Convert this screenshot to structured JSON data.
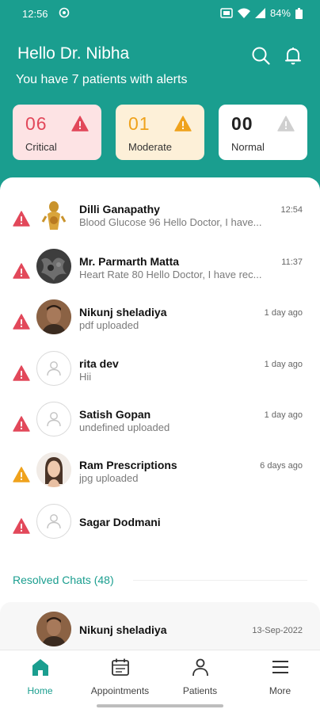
{
  "status_bar": {
    "time": "12:56",
    "battery": "84%"
  },
  "header": {
    "greeting": "Hello Dr. Nibha",
    "subtitle": "You have 7 patients with alerts"
  },
  "summary_cards": {
    "critical": {
      "count": "06",
      "label": "Critical"
    },
    "moderate": {
      "count": "01",
      "label": "Moderate"
    },
    "normal": {
      "count": "00",
      "label": "Normal"
    }
  },
  "chats": [
    {
      "name": "Dilli Ganapathy",
      "message": "Blood Glucose 96 Hello Doctor, I have...",
      "time": "12:54",
      "severity": "critical",
      "avatar": "photo-figurine"
    },
    {
      "name": "Mr. Parmarth Matta",
      "message": "Heart Rate 80 Hello Doctor, I have rec...",
      "time": "11:37",
      "severity": "critical",
      "avatar": "photo-dark"
    },
    {
      "name": "Nikunj sheladiya",
      "message": "pdf uploaded",
      "time": "1 day ago",
      "severity": "critical",
      "avatar": "photo-man"
    },
    {
      "name": "rita dev",
      "message": "Hii",
      "time": "1 day ago",
      "severity": "critical",
      "avatar": "placeholder"
    },
    {
      "name": "Satish Gopan",
      "message": "undefined uploaded",
      "time": "1 day ago",
      "severity": "critical",
      "avatar": "placeholder"
    },
    {
      "name": "Ram Prescriptions",
      "message": "jpg uploaded",
      "time": "6 days ago",
      "severity": "moderate",
      "avatar": "photo-woman"
    },
    {
      "name": "Sagar Dodmani",
      "message": "",
      "time": "",
      "severity": "critical",
      "avatar": "placeholder"
    }
  ],
  "resolved": {
    "label": "Resolved Chats (48)",
    "items": [
      {
        "name": "Nikunj sheladiya",
        "time": "13-Sep-2022",
        "avatar": "photo-man"
      }
    ]
  },
  "bottom_nav": [
    {
      "label": "Home",
      "icon": "home-icon",
      "active": true
    },
    {
      "label": "Appointments",
      "icon": "calendar-icon",
      "active": false
    },
    {
      "label": "Patients",
      "icon": "person-icon",
      "active": false
    },
    {
      "label": "More",
      "icon": "menu-icon",
      "active": false
    }
  ],
  "colors": {
    "brand": "#1a9e8f",
    "critical": "#e2485a",
    "moderate": "#efa21c",
    "normal": "#c9c9c9"
  }
}
